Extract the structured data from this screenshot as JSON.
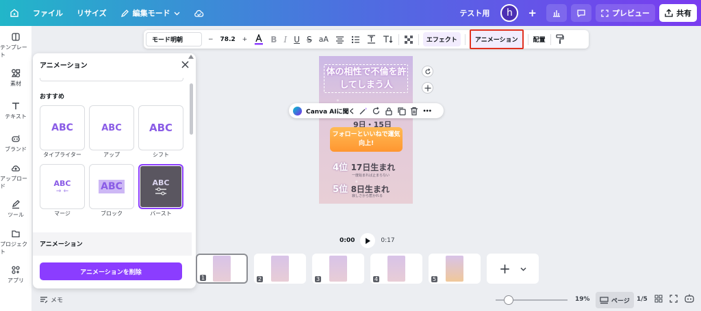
{
  "topbar": {
    "file": "ファイル",
    "resize": "リサイズ",
    "edit_mode": "編集モード",
    "test_label": "テスト用",
    "avatar_initial": "h",
    "preview": "プレビュー",
    "share": "共有"
  },
  "sidebar": {
    "items": [
      {
        "label": "テンプレート",
        "icon": "template-icon"
      },
      {
        "label": "素材",
        "icon": "elements-icon"
      },
      {
        "label": "テキスト",
        "icon": "text-icon"
      },
      {
        "label": "ブランド",
        "icon": "brand-icon"
      },
      {
        "label": "アップロード",
        "icon": "upload-icon"
      },
      {
        "label": "ツール",
        "icon": "draw-icon"
      },
      {
        "label": "プロジェクト",
        "icon": "folder-icon"
      },
      {
        "label": "アプリ",
        "icon": "apps-icon"
      }
    ]
  },
  "toolbar": {
    "font": "モード明朝",
    "font_size": "78.2",
    "effect": "エフェクト",
    "animation": "アニメーション",
    "position": "配置",
    "minus": "−",
    "plus": "+",
    "case": "aA",
    "bold": "B",
    "italic": "I",
    "underline": "U",
    "strike": "S"
  },
  "panel": {
    "title": "アニメーション",
    "recommended": "おすすめ",
    "section_animation": "アニメーション",
    "delete_button": "アニメーションを削除",
    "cards": [
      {
        "label": "タイプライター",
        "preview": "ABC"
      },
      {
        "label": "アップ",
        "preview": "ABC"
      },
      {
        "label": "シフト",
        "preview": "ABC"
      },
      {
        "label": "マージ",
        "preview": "ABC"
      },
      {
        "label": "ブロック",
        "preview": "ABC"
      },
      {
        "label": "バースト",
        "preview": "ABC"
      }
    ],
    "selected_index": 5
  },
  "canvas": {
    "title": "体の相性で不倫を許してしまう人",
    "orange_text": "フォローといいねで運気向上!",
    "rank_hint": "9日・15日",
    "rank4_num": "4位",
    "rank4_text": "17日生まれ",
    "rank4_sub": "一度始まれば止まらない",
    "rank5_num": "5位",
    "rank5_text": "8日生まれ",
    "rank5_sub": "寂しさから惹かれる"
  },
  "ai_bar": {
    "label": "Canva AIに聞く",
    "more": "•••"
  },
  "playback": {
    "current": "0:00",
    "total": "0:17"
  },
  "pages": [
    {
      "num": "1"
    },
    {
      "num": "2"
    },
    {
      "num": "3"
    },
    {
      "num": "4"
    },
    {
      "num": "5"
    }
  ],
  "add_page": "+",
  "bottom": {
    "memo": "メモ",
    "zoom": "19%",
    "pages_label": "ページ",
    "page_count": "1/5"
  },
  "colors": {
    "accent": "#8b3dff",
    "highlight": "#e0301e"
  }
}
